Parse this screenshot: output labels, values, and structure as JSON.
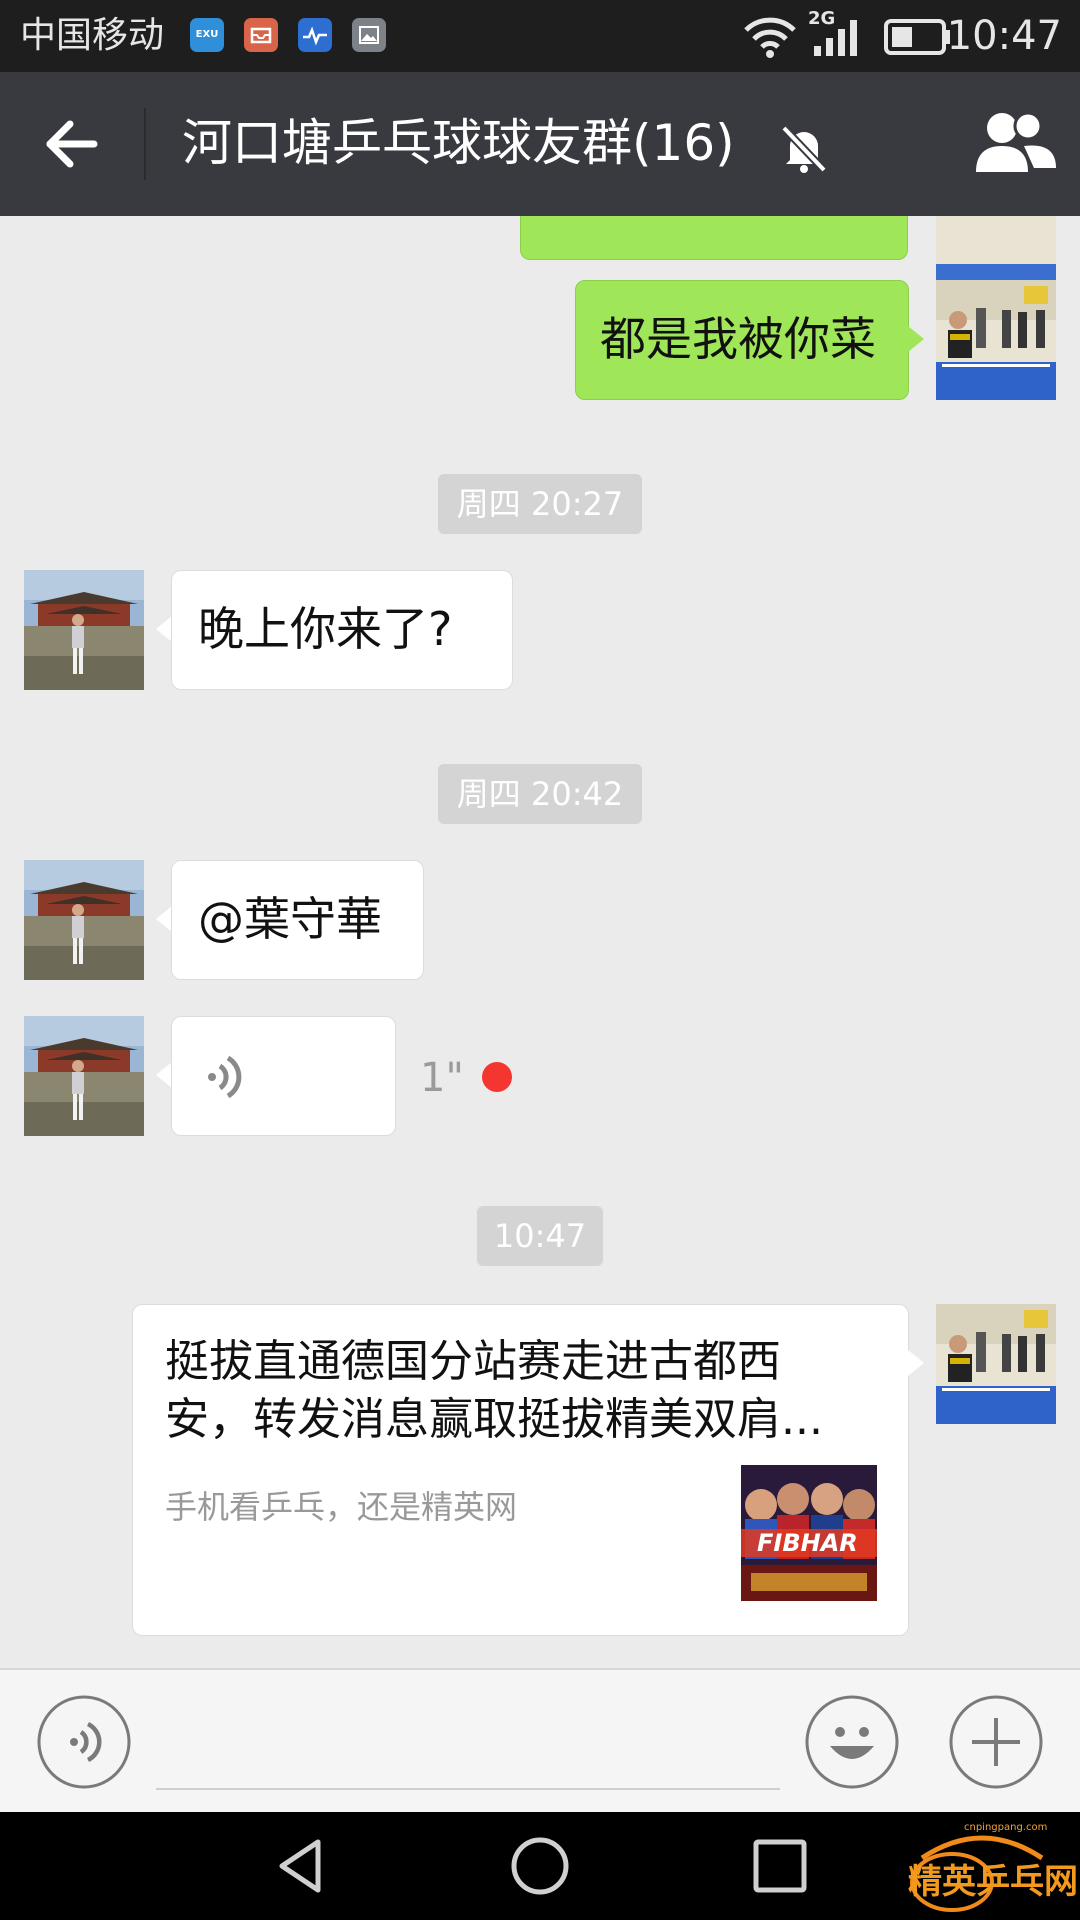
{
  "status_bar": {
    "carrier": "中国移动",
    "app_icons": [
      "EXU",
      "mail-icon",
      "health-icon",
      "gallery-icon"
    ],
    "network": "2G",
    "time": "10:47"
  },
  "header": {
    "title": "河口塘乒乓球球友群(16)",
    "muted": true
  },
  "messages": {
    "m1": {
      "sender": "self",
      "text": "都是我被你菜"
    },
    "ts1": "周四 20:27",
    "m2": {
      "sender": "other",
      "text": "晚上你来了?"
    },
    "ts2": "周四 20:42",
    "m3": {
      "sender": "other",
      "text": "@葉守華"
    },
    "m4": {
      "sender": "other",
      "type": "voice",
      "duration": "1\"",
      "unread": true
    },
    "ts3": "10:47",
    "m5": {
      "sender": "self",
      "type": "link",
      "title": "挺拔直通德国分站赛走进古都西安，转发消息赢取挺拔精美双肩...",
      "description": "手机看乒乓，还是精英网",
      "thumb_text": "FIBHAR"
    }
  },
  "watermark": {
    "brand": "精英乒乓网",
    "url": "cnpingpang.com"
  },
  "colors": {
    "title_bar": "#393a3f",
    "sent_bubble": "#9fe658",
    "received_bubble": "#ffffff",
    "unread_dot": "#f43530",
    "chat_bg": "#ebebeb"
  }
}
